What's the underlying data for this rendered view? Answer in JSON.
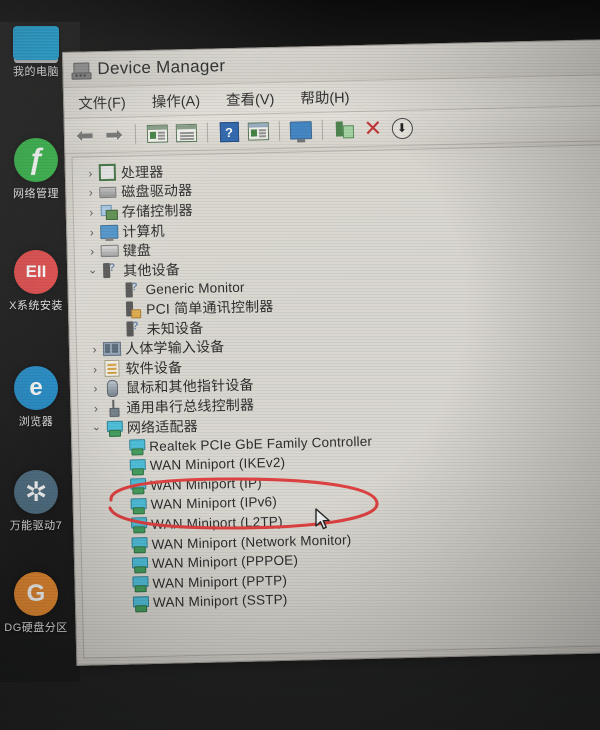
{
  "desktop": {
    "icons": [
      {
        "label": "我的电脑",
        "icon": "my-computer-icon",
        "color": "#19a8e0",
        "glyph": "",
        "shape": "sq"
      },
      {
        "label": "网络管理",
        "icon": "network-manager-icon",
        "color": "#2fb344",
        "glyph": "ƒ",
        "shape": "round"
      },
      {
        "label": "X系统安装",
        "icon": "system-install-icon",
        "color": "#e04646",
        "glyph": "EII",
        "shape": "round"
      },
      {
        "label": "浏览器",
        "icon": "internet-explorer-icon",
        "color": "#1e8bc8",
        "glyph": "e",
        "shape": "round"
      },
      {
        "label": "万能驱动7",
        "icon": "driver-tool-gear-icon",
        "color": "#4a6b80",
        "glyph": "✲",
        "shape": "round"
      },
      {
        "label": "DG硬盘分区",
        "icon": "disk-partition-icon",
        "color": "#e8882a",
        "glyph": "G",
        "shape": "round"
      }
    ]
  },
  "window": {
    "title": "Device Manager",
    "title_icon": "device-manager-icon",
    "menu": [
      {
        "label": "文件(F)"
      },
      {
        "label": "操作(A)"
      },
      {
        "label": "查看(V)"
      },
      {
        "label": "帮助(H)"
      }
    ],
    "toolbar": [
      {
        "name": "back-arrow-icon",
        "type": "arrow",
        "glyph": "⬅"
      },
      {
        "name": "forward-arrow-icon",
        "type": "arrow",
        "glyph": "➡"
      },
      {
        "name": "separator-1",
        "type": "sep"
      },
      {
        "name": "show-hide-console-tree-icon",
        "type": "win-green"
      },
      {
        "name": "properties-icon",
        "type": "win-plain"
      },
      {
        "name": "separator-2",
        "type": "sep"
      },
      {
        "name": "help-icon",
        "type": "help",
        "glyph": "?"
      },
      {
        "name": "update-driver-icon",
        "type": "win-blue"
      },
      {
        "name": "separator-3",
        "type": "sep"
      },
      {
        "name": "scan-for-hardware-changes-icon",
        "type": "monitor"
      },
      {
        "name": "separator-4",
        "type": "sep"
      },
      {
        "name": "add-legacy-hardware-icon",
        "type": "plug"
      },
      {
        "name": "uninstall-device-icon",
        "type": "x",
        "glyph": "✕"
      },
      {
        "name": "disable-device-icon",
        "type": "down",
        "glyph": "⬇"
      }
    ],
    "tree": [
      {
        "label": "处理器",
        "indent": 0,
        "chev": "collapsed",
        "icon": "cpu-icon",
        "icon_type": "cpu"
      },
      {
        "label": "磁盘驱动器",
        "indent": 0,
        "chev": "collapsed",
        "icon": "disk-drive-icon",
        "icon_type": "disk"
      },
      {
        "label": "存储控制器",
        "indent": 0,
        "chev": "collapsed",
        "icon": "storage-controller-icon",
        "icon_type": "storage"
      },
      {
        "label": "计算机",
        "indent": 0,
        "chev": "collapsed",
        "icon": "computer-icon",
        "icon_type": "comp"
      },
      {
        "label": "键盘",
        "indent": 0,
        "chev": "collapsed",
        "icon": "keyboard-icon",
        "icon_type": "kbd"
      },
      {
        "label": "其他设备",
        "indent": 0,
        "chev": "expanded",
        "icon": "other-devices-icon",
        "icon_type": "unk"
      },
      {
        "label": "Generic Monitor",
        "indent": 1,
        "chev": "none",
        "icon": "unknown-device-icon",
        "icon_type": "unk"
      },
      {
        "label": "PCI 简单通讯控制器",
        "indent": 1,
        "chev": "none",
        "icon": "unknown-device-warning-icon",
        "icon_type": "unkw"
      },
      {
        "label": "未知设备",
        "indent": 1,
        "chev": "none",
        "icon": "unknown-device-icon",
        "icon_type": "unk"
      },
      {
        "label": "人体学输入设备",
        "indent": 0,
        "chev": "collapsed",
        "icon": "hid-icon",
        "icon_type": "hid"
      },
      {
        "label": "软件设备",
        "indent": 0,
        "chev": "collapsed",
        "icon": "software-device-icon",
        "icon_type": "soft"
      },
      {
        "label": "鼠标和其他指针设备",
        "indent": 0,
        "chev": "collapsed",
        "icon": "mouse-icon",
        "icon_type": "mouse"
      },
      {
        "label": "通用串行总线控制器",
        "indent": 0,
        "chev": "collapsed",
        "icon": "usb-controller-icon",
        "icon_type": "usb"
      },
      {
        "label": "网络适配器",
        "indent": 0,
        "chev": "expanded",
        "icon": "network-adapter-icon",
        "icon_type": "net"
      },
      {
        "label": "Realtek PCIe GbE Family Controller",
        "indent": 1,
        "chev": "none",
        "icon": "network-adapter-icon",
        "icon_type": "net"
      },
      {
        "label": "WAN Miniport (IKEv2)",
        "indent": 1,
        "chev": "none",
        "icon": "network-adapter-icon",
        "icon_type": "net"
      },
      {
        "label": "WAN Miniport (IP)",
        "indent": 1,
        "chev": "none",
        "icon": "network-adapter-icon",
        "icon_type": "net"
      },
      {
        "label": "WAN Miniport (IPv6)",
        "indent": 1,
        "chev": "none",
        "icon": "network-adapter-icon",
        "icon_type": "net"
      },
      {
        "label": "WAN Miniport (L2TP)",
        "indent": 1,
        "chev": "none",
        "icon": "network-adapter-icon",
        "icon_type": "net"
      },
      {
        "label": "WAN Miniport (Network Monitor)",
        "indent": 1,
        "chev": "none",
        "icon": "network-adapter-icon",
        "icon_type": "net"
      },
      {
        "label": "WAN Miniport (PPPOE)",
        "indent": 1,
        "chev": "none",
        "icon": "network-adapter-icon",
        "icon_type": "net"
      },
      {
        "label": "WAN Miniport (PPTP)",
        "indent": 1,
        "chev": "none",
        "icon": "network-adapter-icon",
        "icon_type": "net"
      },
      {
        "label": "WAN Miniport (SSTP)",
        "indent": 1,
        "chev": "none",
        "icon": "network-adapter-icon",
        "icon_type": "net"
      }
    ]
  },
  "annotation": {
    "shape": "hand-drawn-ellipse",
    "color": "#e03a3a",
    "target_label": "Realtek PCIe GbE Family Controller"
  },
  "cursor": {
    "type": "arrow-pointer"
  },
  "chevrons": {
    "collapsed": "›",
    "expanded": "⌄"
  }
}
